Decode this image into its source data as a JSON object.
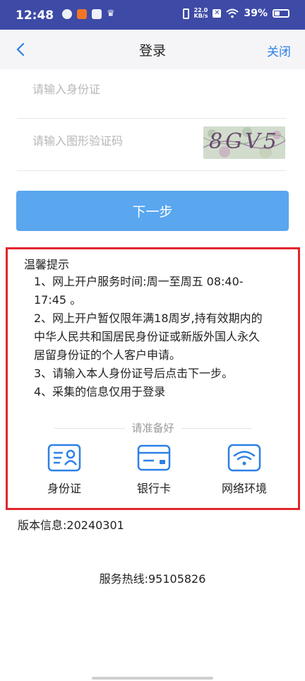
{
  "status_bar": {
    "time": "12:48",
    "net_speed_value": "22.0",
    "net_speed_unit": "KB/s",
    "battery_text": "39%",
    "battery_level": 0.39
  },
  "nav": {
    "title": "登录",
    "close_label": "关闭"
  },
  "form": {
    "id_placeholder": "请输入身份证",
    "captcha_placeholder": "请输入图形验证码",
    "captcha_text": "8GV5",
    "next_label": "下一步"
  },
  "tips": {
    "title": "温馨提示",
    "lines": [
      "1、网上开户服务时间:周一至周五 08:40-",
      "17:45 。",
      "2、网上开户暂仅限年满18周岁,持有效期内的",
      "中华人民共和国居民身份证或新版外国人永久",
      "居留身份证的个人客户申请。",
      "3、请输入本人身份证号后点击下一步。",
      "4、采集的信息仅用于登录"
    ]
  },
  "prepare": {
    "heading": "请准备好",
    "items": [
      {
        "label": "身份证",
        "icon": "id-card-icon"
      },
      {
        "label": "银行卡",
        "icon": "bank-card-icon"
      },
      {
        "label": "网络环境",
        "icon": "wifi-icon"
      }
    ]
  },
  "footer": {
    "version": "版本信息:20240301",
    "hotline": "服务热线:95105826"
  },
  "colors": {
    "status_bar": "#3d4aa6",
    "accent": "#2b80e8",
    "button": "#5aa6ef",
    "highlight_border": "#e1252d"
  }
}
